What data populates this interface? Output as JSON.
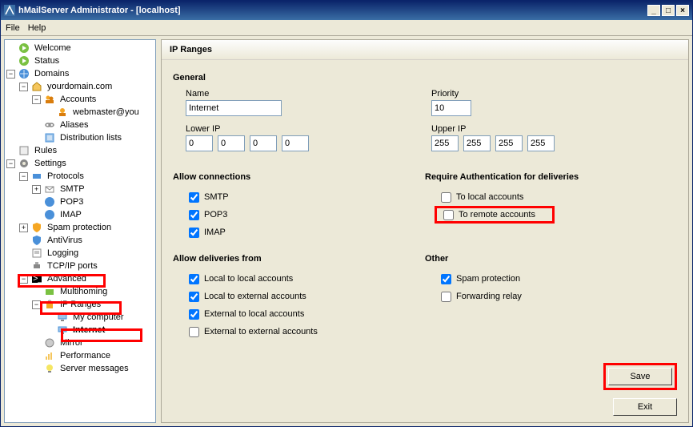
{
  "window": {
    "title": "hMailServer Administrator - [localhost]"
  },
  "menu": {
    "file": "File",
    "help": "Help"
  },
  "tree": {
    "welcome": "Welcome",
    "status": "Status",
    "domains": "Domains",
    "domain0": "yourdomain.com",
    "accounts": "Accounts",
    "account0": "webmaster@you",
    "aliases": "Aliases",
    "distlists": "Distribution lists",
    "rules": "Rules",
    "settings": "Settings",
    "protocols": "Protocols",
    "smtp": "SMTP",
    "pop3": "POP3",
    "imap": "IMAP",
    "spam": "Spam protection",
    "antivirus": "AntiVirus",
    "logging": "Logging",
    "tcpip": "TCP/IP ports",
    "advanced": "Advanced",
    "multihoming": "Multihoming",
    "ipranges": "IP Ranges",
    "mycomputer": "My computer",
    "internet": "Internet",
    "mirror": "Mirror",
    "performance": "Performance",
    "servermsg": "Server messages"
  },
  "pane": {
    "title": "IP Ranges",
    "general": "General",
    "name_label": "Name",
    "name_value": "Internet",
    "priority_label": "Priority",
    "priority_value": "10",
    "lowerip_label": "Lower IP",
    "upperip_label": "Upper IP",
    "lip": [
      "0",
      "0",
      "0",
      "0"
    ],
    "uip": [
      "255",
      "255",
      "255",
      "255"
    ],
    "allowconn": "Allow connections",
    "c_smtp": "SMTP",
    "c_pop3": "POP3",
    "c_imap": "IMAP",
    "allowdel": "Allow deliveries from",
    "d_ll": "Local to local accounts",
    "d_le": "Local to external accounts",
    "d_el": "External to local accounts",
    "d_ee": "External to external accounts",
    "reqauth": "Require Authentication for deliveries",
    "r_local": "To local accounts",
    "r_remote": "To remote accounts",
    "other": "Other",
    "o_spam": "Spam protection",
    "o_fwd": "Forwarding relay",
    "save": "Save",
    "exit": "Exit"
  }
}
